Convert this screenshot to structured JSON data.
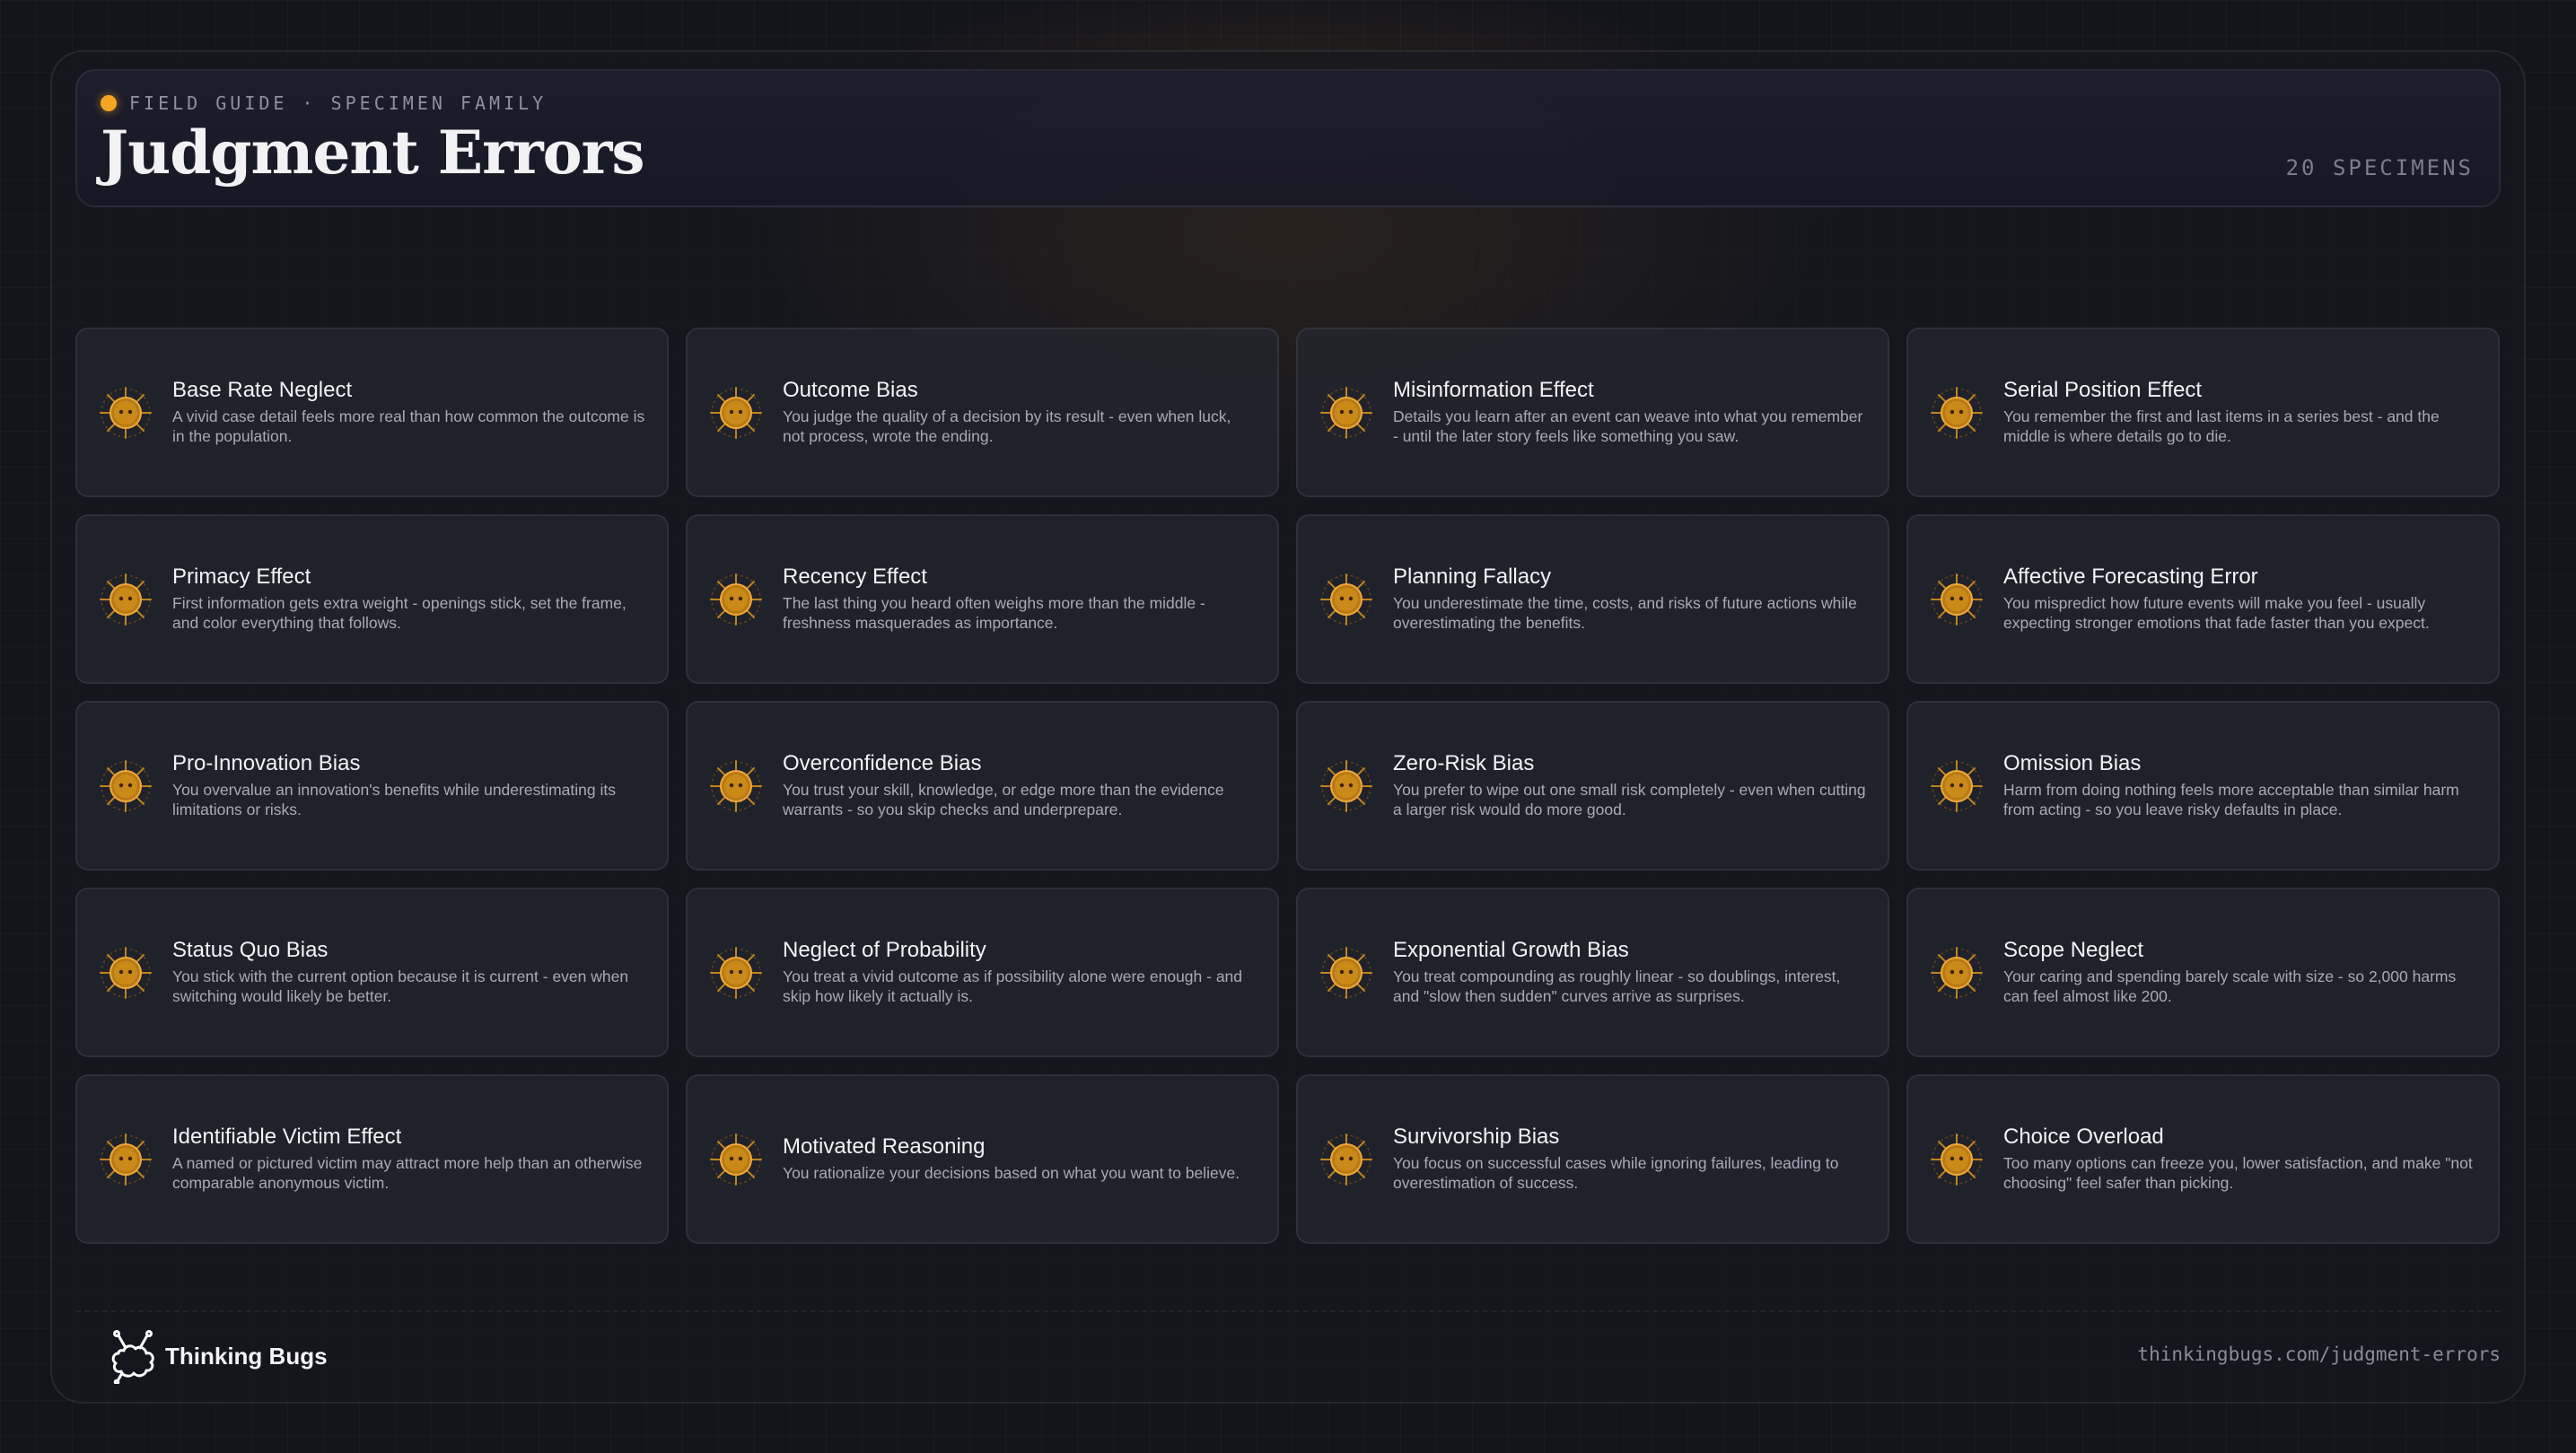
{
  "header": {
    "eyebrow": "FIELD GUIDE · SPECIMEN FAMILY",
    "title": "Judgment Errors",
    "count": "20 SPECIMENS"
  },
  "colors": {
    "accent": "#f5a524",
    "bug_body": "#c98a1a",
    "background": "#13141b",
    "card": "#24252f"
  },
  "specimens": [
    {
      "title": "Base Rate Neglect",
      "desc": "A vivid case detail feels more real than how common the outcome is in the population.",
      "icon": "bug-specimen-icon"
    },
    {
      "title": "Outcome Bias",
      "desc": "You judge the quality of a decision by its result - even when luck, not process, wrote the ending.",
      "icon": "bug-specimen-icon"
    },
    {
      "title": "Misinformation Effect",
      "desc": "Details you learn after an event can weave into what you remember - until the later story feels like something you saw.",
      "icon": "bug-specimen-icon"
    },
    {
      "title": "Serial Position Effect",
      "desc": "You remember the first and last items in a series best - and the middle is where details go to die.",
      "icon": "bug-specimen-icon"
    },
    {
      "title": "Primacy Effect",
      "desc": "First information gets extra weight - openings stick, set the frame, and color everything that follows.",
      "icon": "bug-specimen-icon"
    },
    {
      "title": "Recency Effect",
      "desc": "The last thing you heard often weighs more than the middle - freshness masquerades as importance.",
      "icon": "bug-specimen-icon"
    },
    {
      "title": "Planning Fallacy",
      "desc": "You underestimate the time, costs, and risks of future actions while overestimating the benefits.",
      "icon": "bug-specimen-icon"
    },
    {
      "title": "Affective Forecasting Error",
      "desc": "You mispredict how future events will make you feel - usually expecting stronger emotions that fade faster than you expect.",
      "icon": "bug-specimen-icon"
    },
    {
      "title": "Pro-Innovation Bias",
      "desc": "You overvalue an innovation's benefits while underestimating its limitations or risks.",
      "icon": "bug-specimen-icon"
    },
    {
      "title": "Overconfidence Bias",
      "desc": "You trust your skill, knowledge, or edge more than the evidence warrants - so you skip checks and underprepare.",
      "icon": "bug-specimen-icon"
    },
    {
      "title": "Zero-Risk Bias",
      "desc": "You prefer to wipe out one small risk completely - even when cutting a larger risk would do more good.",
      "icon": "bug-specimen-icon"
    },
    {
      "title": "Omission Bias",
      "desc": "Harm from doing nothing feels more acceptable than similar harm from acting - so you leave risky defaults in place.",
      "icon": "bug-specimen-icon"
    },
    {
      "title": "Status Quo Bias",
      "desc": "You stick with the current option because it is current - even when switching would likely be better.",
      "icon": "bug-specimen-icon"
    },
    {
      "title": "Neglect of Probability",
      "desc": "You treat a vivid outcome as if possibility alone were enough - and skip how likely it actually is.",
      "icon": "bug-specimen-icon"
    },
    {
      "title": "Exponential Growth Bias",
      "desc": "You treat compounding as roughly linear - so doublings, interest, and \"slow then sudden\" curves arrive as surprises.",
      "icon": "bug-specimen-icon"
    },
    {
      "title": "Scope Neglect",
      "desc": "Your caring and spending barely scale with size - so 2,000 harms can feel almost like 200.",
      "icon": "bug-specimen-icon"
    },
    {
      "title": "Identifiable Victim Effect",
      "desc": "A named or pictured victim may attract more help than an otherwise comparable anonymous victim.",
      "icon": "bug-specimen-icon"
    },
    {
      "title": "Motivated Reasoning",
      "desc": "You rationalize your decisions based on what you want to believe.",
      "icon": "bug-specimen-icon"
    },
    {
      "title": "Survivorship Bias",
      "desc": "You focus on successful cases while ignoring failures, leading to overestimation of success.",
      "icon": "bug-specimen-icon"
    },
    {
      "title": "Choice Overload",
      "desc": "Too many options can freeze you, lower satisfaction, and make \"not choosing\" feel safer than picking.",
      "icon": "bug-specimen-icon"
    }
  ],
  "footer": {
    "brand": "Thinking Bugs",
    "brand_icon": "thinking-bugs-logo-icon",
    "url": "thinkingbugs.com/judgment-errors"
  }
}
